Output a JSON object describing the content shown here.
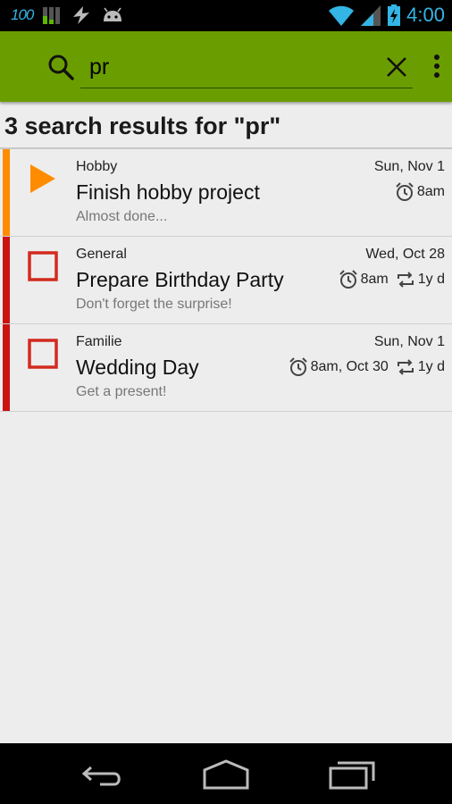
{
  "status_bar": {
    "battery_level_text": "100",
    "time": "4:00"
  },
  "search": {
    "query": "pr"
  },
  "results": {
    "header": "3 search results for \"pr\""
  },
  "tasks": [
    {
      "list_name": "Hobby",
      "title": "Finish hobby project",
      "note": "Almost done...",
      "date": "Sun, Nov 1",
      "reminder": "8am",
      "repeat": "",
      "priority_color": "#ff8c00",
      "state": "in-progress"
    },
    {
      "list_name": "General",
      "title": "Prepare Birthday Party",
      "note": "Don't forget the surprise!",
      "date": "Wed, Oct 28",
      "reminder": "8am",
      "repeat": "1y d",
      "priority_color": "#cc1111",
      "state": "open"
    },
    {
      "list_name": "Familie",
      "title": "Wedding Day",
      "note": "Get a present!",
      "date": "Sun, Nov 1",
      "reminder": "8am, Oct 30",
      "repeat": "1y d",
      "priority_color": "#cc1111",
      "state": "open"
    }
  ],
  "colors": {
    "action_bar": "#6a9e00",
    "status_accent": "#33b5e5",
    "play_icon": "#ff8c00",
    "checkbox_red": "#d22a1e"
  }
}
